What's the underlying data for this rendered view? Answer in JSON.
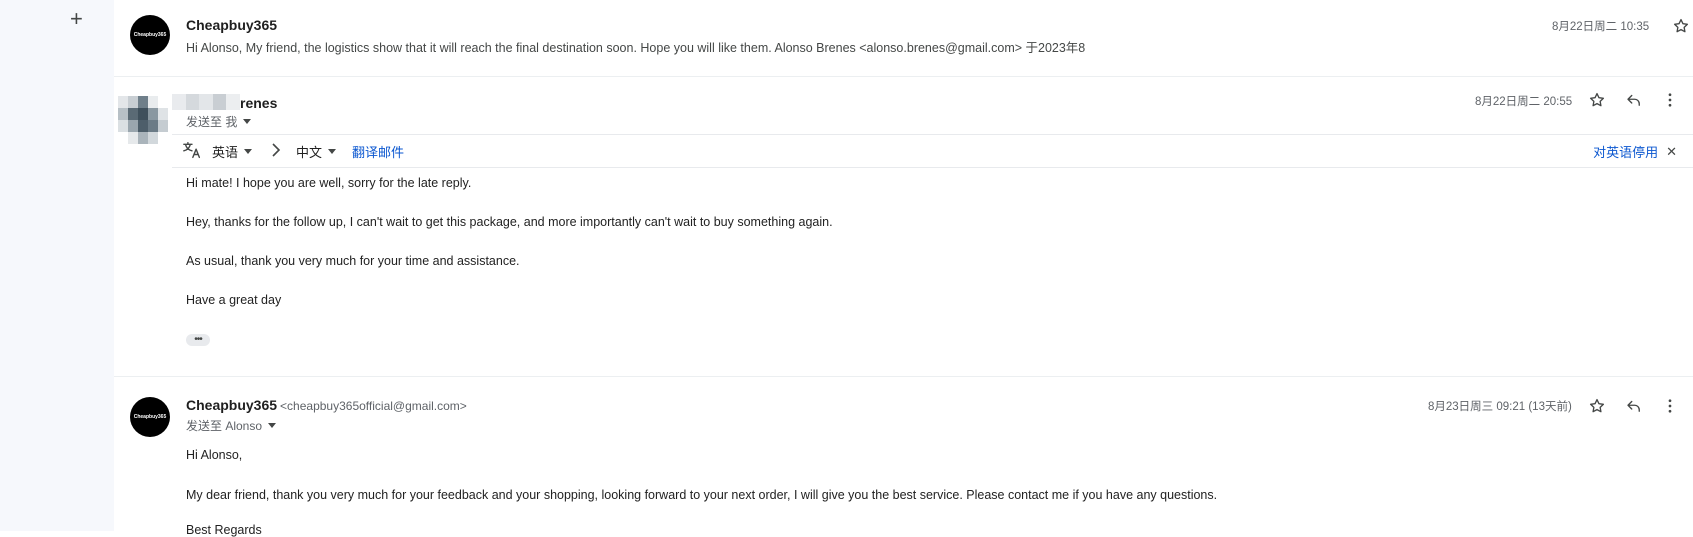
{
  "rail": {
    "compose_icon": "plus-icon"
  },
  "messages": [
    {
      "sender": "Cheapbuy365",
      "avatar_text": "Cheapbuy365",
      "snippet": "Hi Alonso, My friend, the logistics show that it will reach the final destination soon. Hope you will like them. Alonso Brenes <alonso.brenes@gmail.com> 于2023年8",
      "date": "8月22日周二 10:35"
    },
    {
      "sender": "renes",
      "recipient": "发送至 我",
      "date": "8月22日周二 20:55",
      "translate": {
        "from_lang": "英语",
        "to_lang": "中文",
        "translate_link": "翻译邮件",
        "stop_link": "对英语停用"
      },
      "body": [
        "Hi mate! I hope you are well, sorry for the late reply.",
        "Hey, thanks for the follow up, I can't wait to get this package, and more importantly can't wait to buy something again.",
        "As usual, thank you very much for your time and assistance.",
        "Have a great day"
      ],
      "more": "•••"
    },
    {
      "sender": "Cheapbuy365",
      "sender_email": "<cheapbuy365official@gmail.com>",
      "avatar_text": "Cheapbuy365",
      "recipient": "发送至 Alonso",
      "date": "8月23日周三 09:21 (13天前)",
      "body": [
        "Hi Alonso,",
        "My dear friend, thank you very much for your feedback and your shopping, looking forward to your next order, I will give you the best service. Please contact me if you have any questions.",
        "Best Regards"
      ]
    }
  ],
  "colors": {
    "link": "#0b57d0",
    "rail_bg": "#f6f8fc",
    "avatar_bg": "#000000"
  }
}
